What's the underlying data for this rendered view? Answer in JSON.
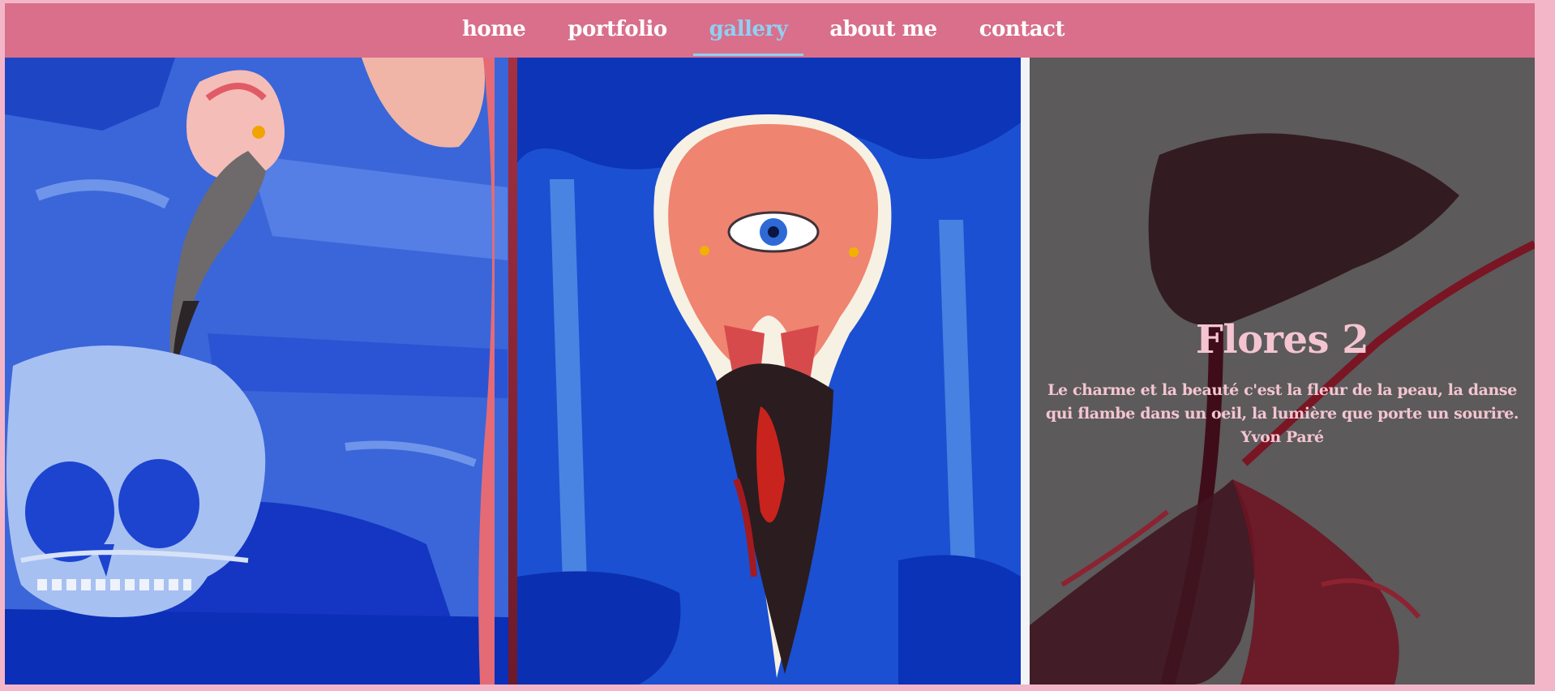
{
  "nav": {
    "items": [
      {
        "label": "home"
      },
      {
        "label": "portfolio"
      },
      {
        "label": "gallery",
        "active": true
      },
      {
        "label": "about me"
      },
      {
        "label": "contact"
      }
    ]
  },
  "gallery": {
    "panel_3": {
      "title": "Flores 2",
      "text": "Le charme et la beauté c'est la fleur de la peau, la danse qui flambe dans un oeil, la lumière que porte un sourire. Yvon Paré"
    }
  },
  "colors": {
    "navbar": "#d96f8b",
    "nav_active": "#8fd0f3",
    "caption": "#f4c5d1"
  }
}
